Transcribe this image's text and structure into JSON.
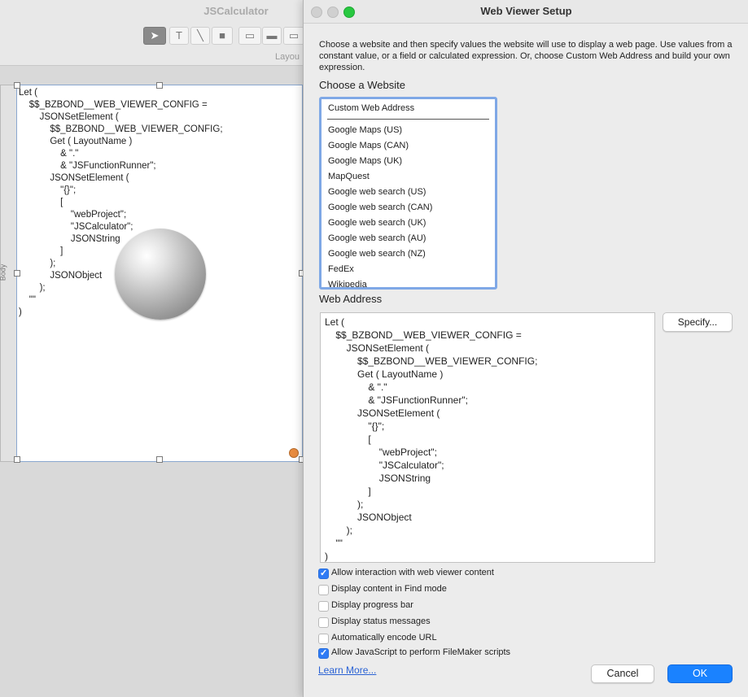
{
  "background_window": {
    "title": "JSCalculator",
    "toolbar_layout_label": "Layou",
    "part_label": "Body",
    "web_viewer_code": "Let (\n\t$$_BZBOND__WEB_VIEWER_CONFIG =\n\t\tJSONSetElement (\n\t\t\t$$_BZBOND__WEB_VIEWER_CONFIG;\n\t\t\tGet ( LayoutName )\n\t\t\t\t& \".\"\n\t\t\t\t& \"JSFunctionRunner\";\n\t\t\tJSONSetElement (\n\t\t\t\t\"{}\";\n\t\t\t\t[\n\t\t\t\t\t\"webProject\";\n\t\t\t\t\t\"JSCalculator\";\n\t\t\t\t\tJSONString\n\t\t\t\t]\n\t\t\t);\n\t\t\tJSONObject\n\t\t);\n\t\"\"\n)",
    "tool_glyphs": {
      "select": "➤",
      "text": "T",
      "line": "╲",
      "rect": "■",
      "field": "▭",
      "button": "▬",
      "more": "▭"
    }
  },
  "dialog": {
    "title": "Web Viewer Setup",
    "description": "Choose a website and then specify values the website will use to display a web page. Use values from a constant value, or a field or calculated expression. Or, choose Custom Web Address and build your own expression.",
    "choose_label": "Choose a Website",
    "websites": [
      "Custom Web Address",
      "Google Maps (US)",
      "Google Maps (CAN)",
      "Google Maps (UK)",
      "MapQuest",
      "Google web search (US)",
      "Google web search (CAN)",
      "Google web search (UK)",
      "Google web search (AU)",
      "Google web search (NZ)",
      "FedEx",
      "Wikipedia"
    ],
    "web_address_label": "Web Address",
    "web_address_code": "Let (\n\t$$_BZBOND__WEB_VIEWER_CONFIG =\n\t\tJSONSetElement (\n\t\t\t$$_BZBOND__WEB_VIEWER_CONFIG;\n\t\t\tGet ( LayoutName )\n\t\t\t\t& \".\"\n\t\t\t\t& \"JSFunctionRunner\";\n\t\t\tJSONSetElement (\n\t\t\t\t\"{}\";\n\t\t\t\t[\n\t\t\t\t\t\"webProject\";\n\t\t\t\t\t\"JSCalculator\";\n\t\t\t\t\tJSONString\n\t\t\t\t]\n\t\t\t);\n\t\t\tJSONObject\n\t\t);\n\t\"\"\n)",
    "specify_button": "Specify...",
    "options": [
      {
        "label": "Allow interaction with web viewer content",
        "checked": true
      },
      {
        "label": "Display content in Find mode",
        "checked": false
      },
      {
        "label": "Display progress bar",
        "checked": false
      },
      {
        "label": "Display status messages",
        "checked": false
      },
      {
        "label": "Automatically encode URL",
        "checked": false
      },
      {
        "label": "Allow JavaScript to perform FileMaker scripts",
        "checked": true
      }
    ],
    "checkmark_glyph": "✓",
    "learn_more": "Learn More...",
    "cancel_button": "Cancel",
    "ok_button": "OK",
    "accent_color": "#1a82ff"
  }
}
